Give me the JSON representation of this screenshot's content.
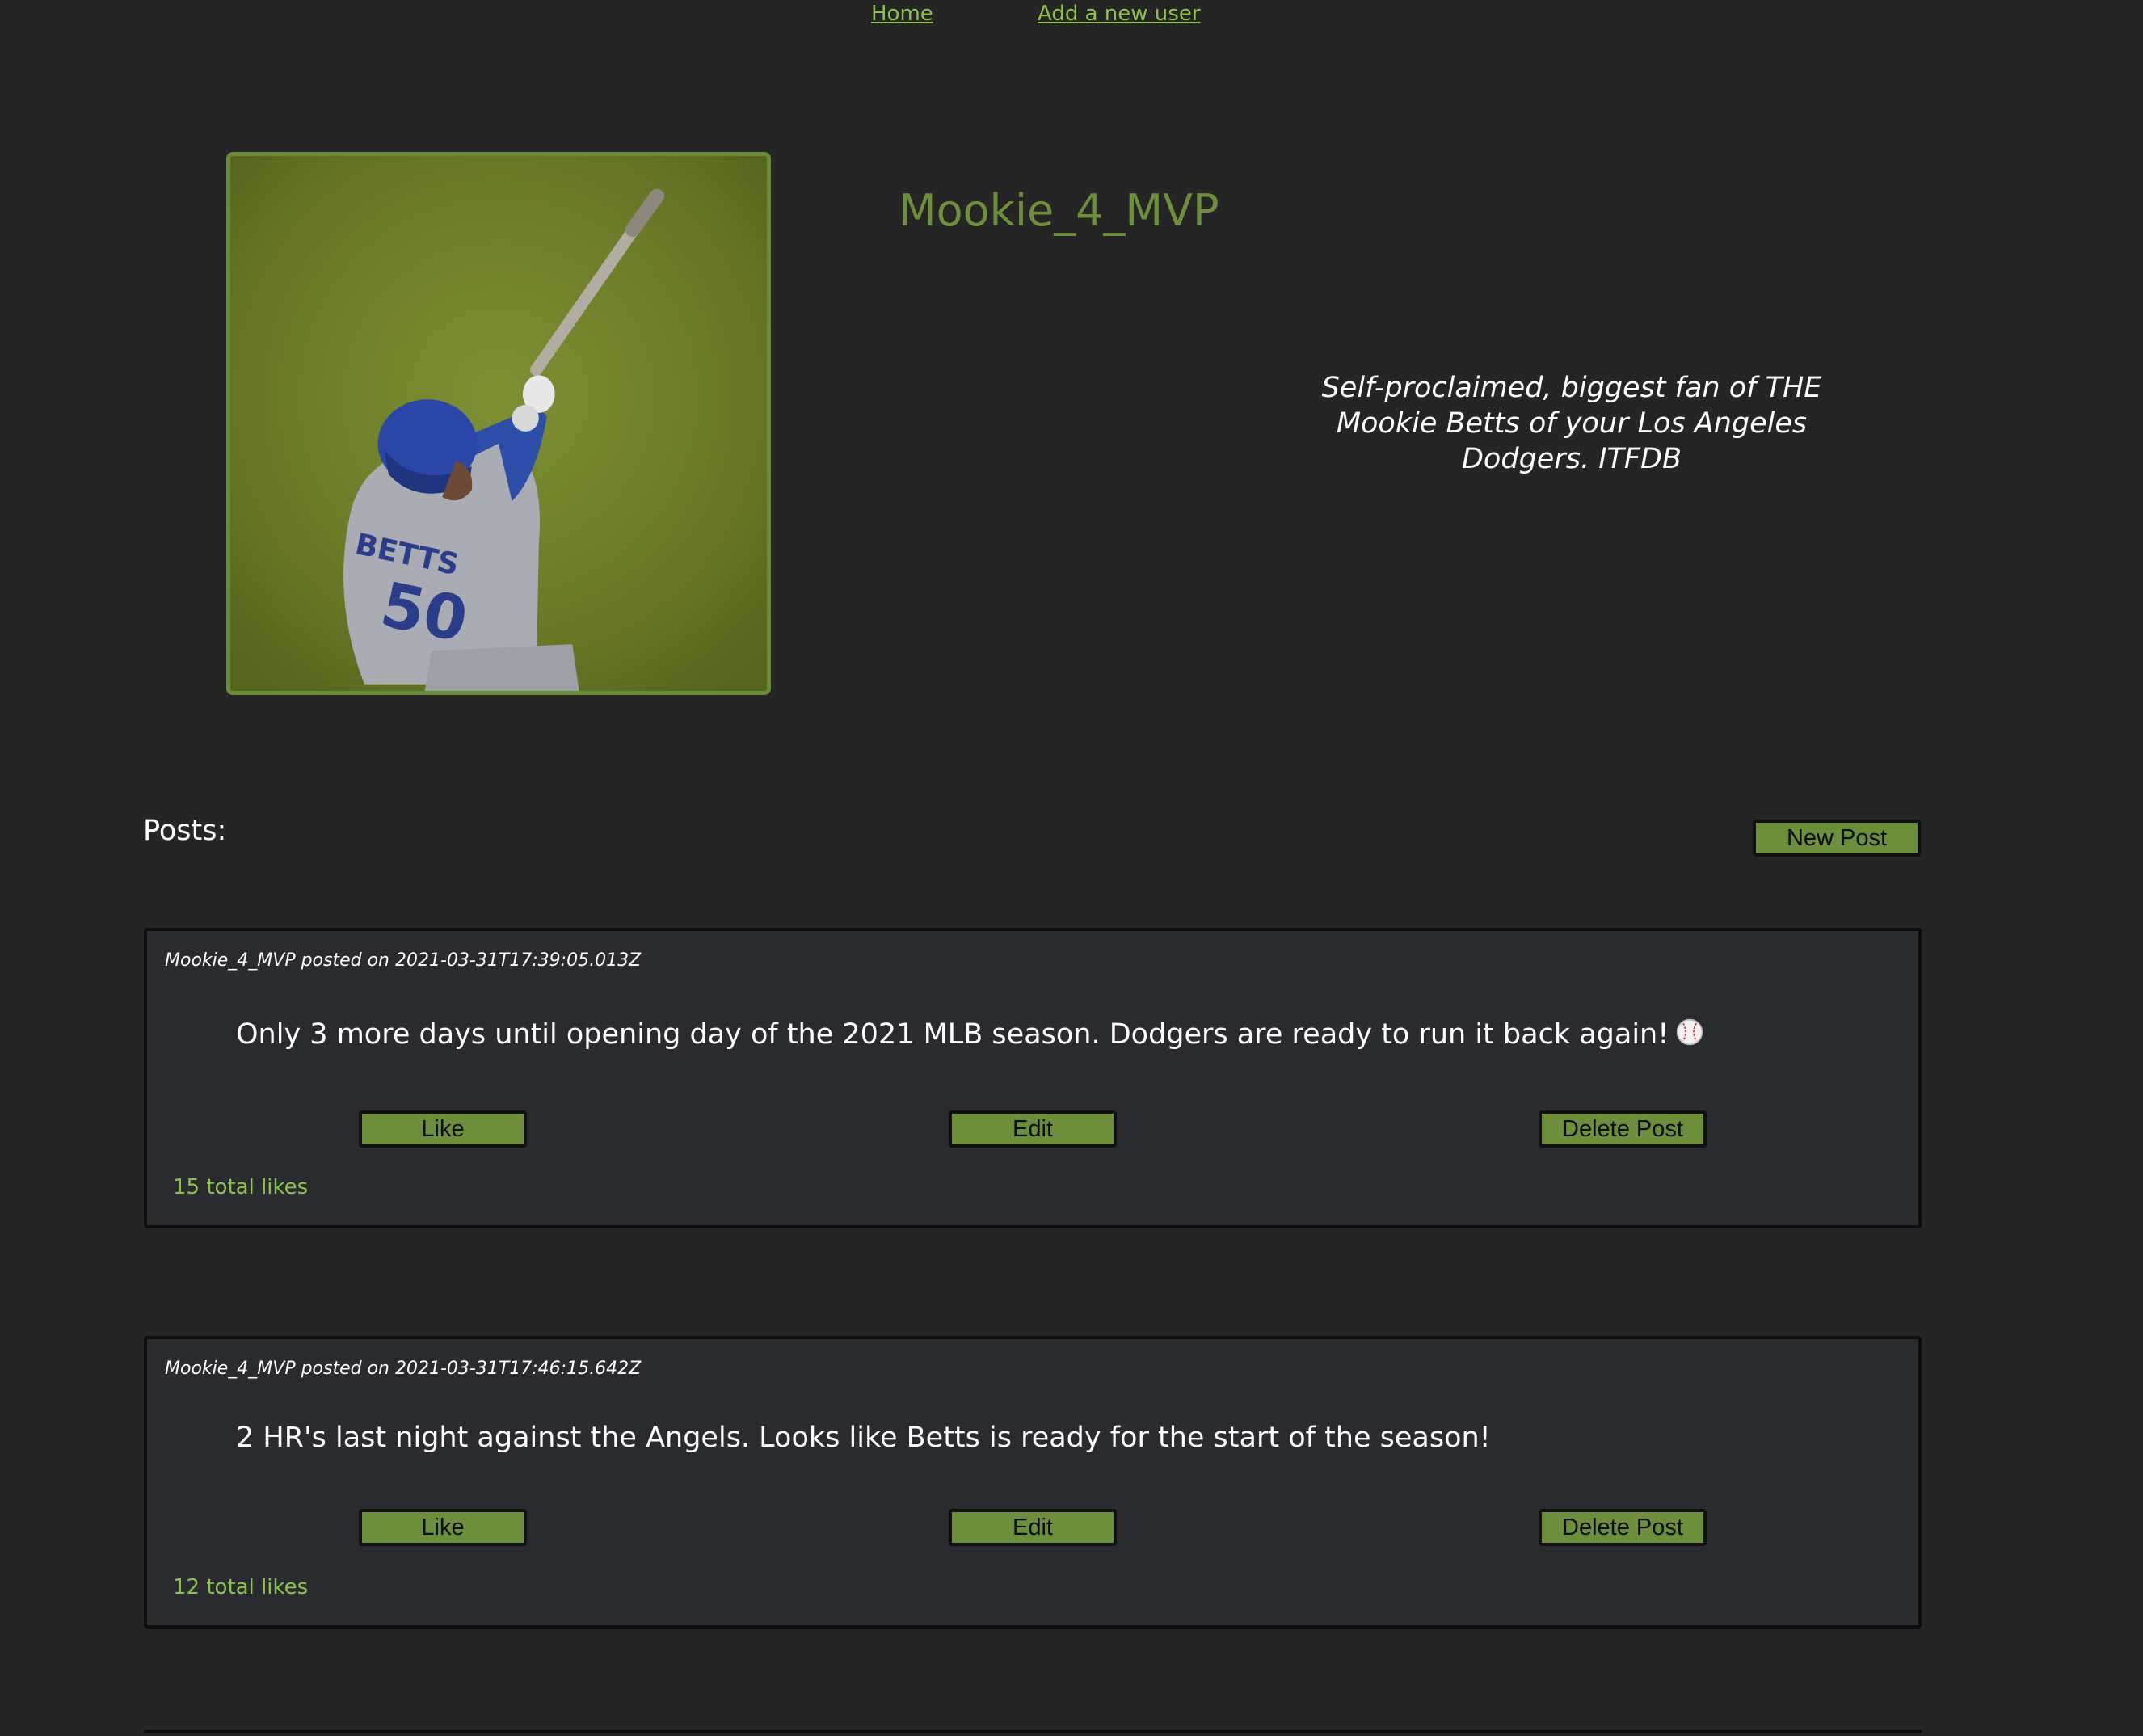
{
  "nav": {
    "home": "Home",
    "add_user": "Add a new user"
  },
  "profile": {
    "username": "Mookie_4_MVP",
    "bio": "Self-proclaimed, biggest fan of THE Mookie Betts of your Los Angeles Dodgers. ITFDB",
    "avatar_icon": "baseball-player-photo"
  },
  "posts_section": {
    "heading": "Posts:",
    "new_post_label": "New Post"
  },
  "posts": [
    {
      "meta": "Mookie_4_MVP posted on 2021-03-31T17:39:05.013Z",
      "body": "Only 3 more days until opening day of the 2021 MLB season. Dodgers are ready to run it back again!",
      "body_icon": "baseball-icon",
      "like_label": "Like",
      "edit_label": "Edit",
      "delete_label": "Delete Post",
      "likes": "15 total likes"
    },
    {
      "meta": "Mookie_4_MVP posted on 2021-03-31T17:46:15.642Z",
      "body": "2 HR's last night against the Angels. Looks like Betts is ready for the start of the season!",
      "like_label": "Like",
      "edit_label": "Edit",
      "delete_label": "Delete Post",
      "likes": "12 total likes"
    }
  ],
  "colors": {
    "background": "#252525",
    "accent": "#6d8f3c",
    "link": "#8bc34a",
    "card": "#2a2b2e"
  }
}
